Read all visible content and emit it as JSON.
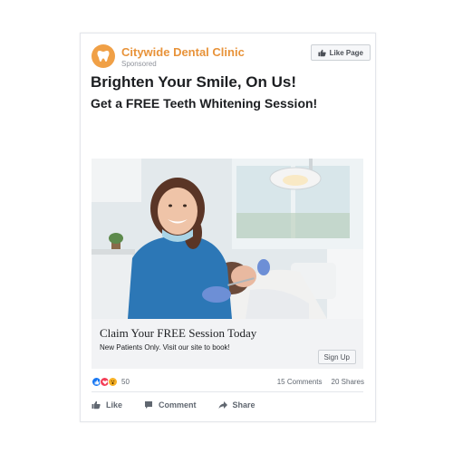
{
  "ad": {
    "page_name": "Citywide Dental Clinic",
    "sponsored": "Sponsored",
    "like_page_label": "Like Page",
    "headline": "Brighten Your Smile, On Us!",
    "subheadline": "Get a FREE Teeth Whitening Session!"
  },
  "cta": {
    "title": "Claim Your FREE Session Today",
    "description": "New Patients Only. Visit our site to book!",
    "button_label": "Sign Up"
  },
  "engagement": {
    "reaction_count": "50",
    "comments": "15 Comments",
    "shares": "20 Shares",
    "reaction_icons": [
      "like-reaction-icon",
      "love-reaction-icon",
      "wow-reaction-icon"
    ]
  },
  "actions": {
    "like": "Like",
    "comment": "Comment",
    "share": "Share"
  },
  "colors": {
    "brand": "#e8933a",
    "like_blue": "#1877f2",
    "love_red": "#f33e58",
    "wow_yellow": "#f7b125"
  }
}
